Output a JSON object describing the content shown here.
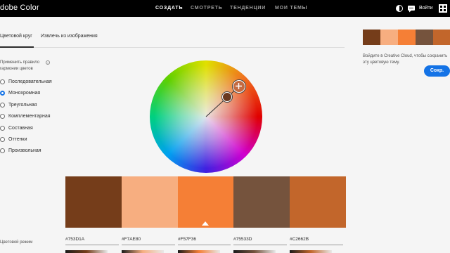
{
  "app": {
    "logo_text": "dobe Color"
  },
  "topnav": {
    "items": [
      "СОЗДАТЬ",
      "СМОТРЕТЬ",
      "ТЕНДЕНЦИИ",
      "МОИ ТЕМЫ"
    ],
    "active_index": 0,
    "signin_label": "Войти"
  },
  "tabs": {
    "items": [
      "Цветовой круг",
      "Извлечь из изображения"
    ],
    "active_index": 0
  },
  "harmony": {
    "label": "Применить правило гармонии цветов",
    "rules": [
      "Последовательная",
      "Монохромная",
      "Треугольная",
      "Комплементарная",
      "Составная",
      "Оттенки",
      "Произвольная"
    ],
    "selected_index": 1
  },
  "palette": {
    "swatches": [
      {
        "hex": "#753D1A"
      },
      {
        "hex": "#F7AE80"
      },
      {
        "hex": "#F57F36"
      },
      {
        "hex": "#75533D"
      },
      {
        "hex": "#C2662B"
      }
    ],
    "selected_index": 2
  },
  "color_mode": {
    "label": "Цветовой режим"
  },
  "sidebar": {
    "cloud_text": "Войдите в Creative Cloud, чтобы сохранить эту цветовую тему.",
    "save_label": "Сохр."
  },
  "colors": {
    "accent": "#1473e6"
  }
}
